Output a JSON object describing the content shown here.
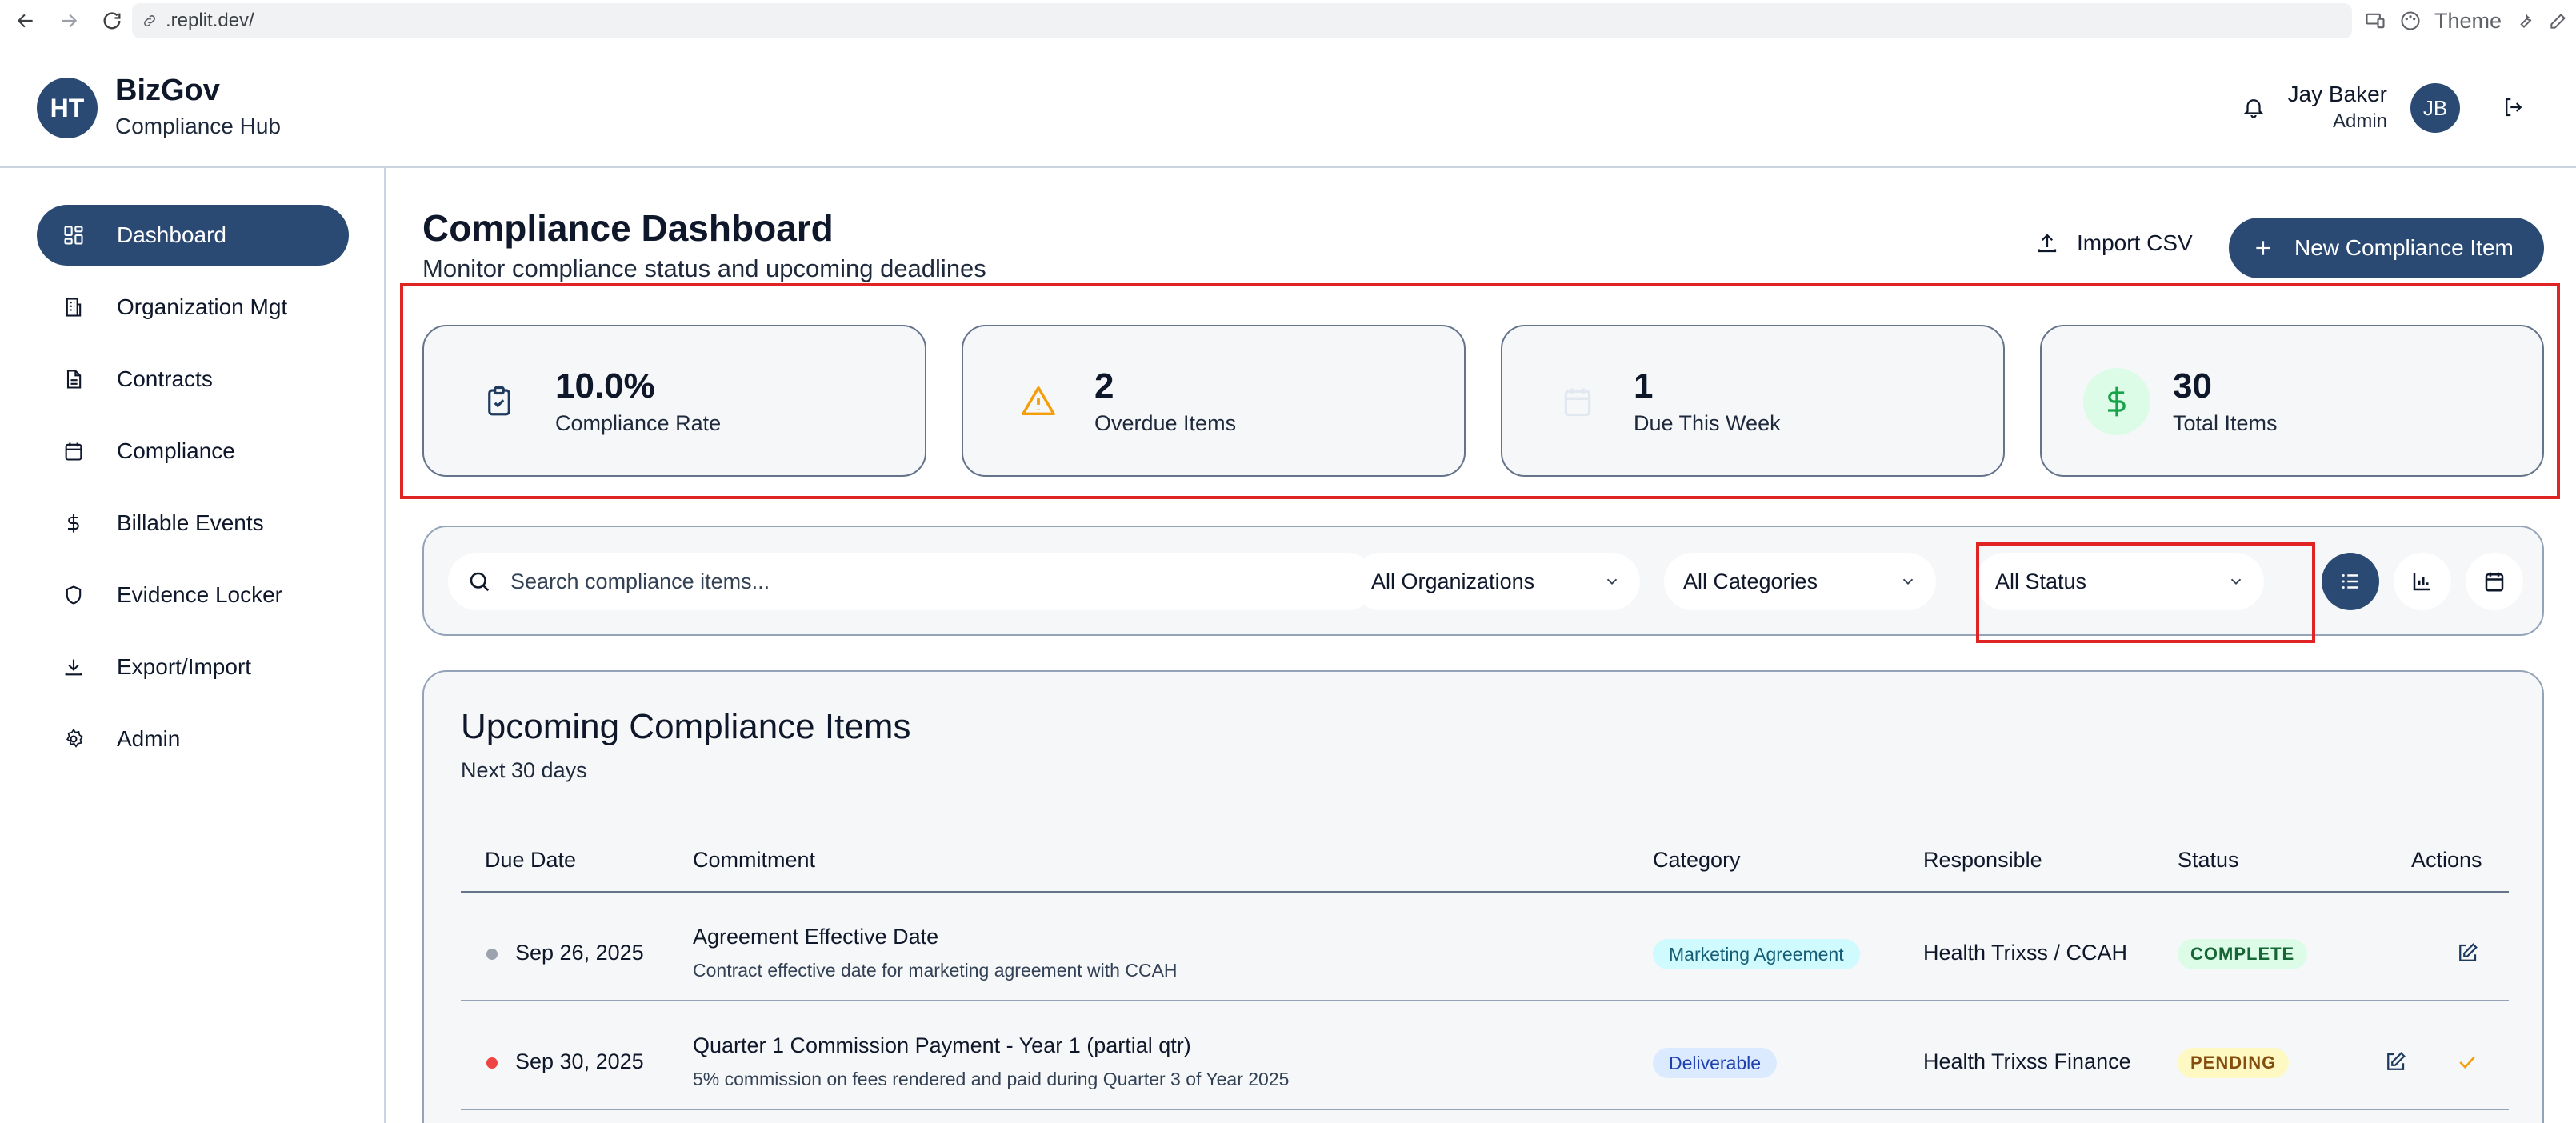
{
  "browser": {
    "url": ".replit.dev/",
    "theme_label": "Theme"
  },
  "header": {
    "logo_initials": "HT",
    "brand_title": "BizGov",
    "brand_subtitle": "Compliance Hub",
    "user_name": "Jay Baker",
    "user_role": "Admin",
    "user_initials": "JB"
  },
  "sidebar": {
    "items": [
      {
        "label": "Dashboard",
        "icon": "dashboard-icon",
        "active": true
      },
      {
        "label": "Organization Mgt",
        "icon": "building-icon",
        "active": false
      },
      {
        "label": "Contracts",
        "icon": "document-icon",
        "active": false
      },
      {
        "label": "Compliance",
        "icon": "calendar-icon",
        "active": false
      },
      {
        "label": "Billable Events",
        "icon": "dollar-icon",
        "active": false
      },
      {
        "label": "Evidence Locker",
        "icon": "shield-icon",
        "active": false
      },
      {
        "label": "Export/Import",
        "icon": "download-icon",
        "active": false
      },
      {
        "label": "Admin",
        "icon": "gear-icon",
        "active": false
      }
    ]
  },
  "page": {
    "title": "Compliance Dashboard",
    "subtitle": "Monitor compliance status and upcoming deadlines",
    "import_label": "Import CSV",
    "new_item_label": "New Compliance Item"
  },
  "stats": [
    {
      "value": "10.0%",
      "label": "Compliance Rate",
      "icon": "clipboard-check-icon",
      "color": "#1e3a5f"
    },
    {
      "value": "2",
      "label": "Overdue Items",
      "icon": "warning-icon",
      "color": "#f59e0b"
    },
    {
      "value": "1",
      "label": "Due This Week",
      "icon": "calendar-icon",
      "color": "#e2e8f0"
    },
    {
      "value": "30",
      "label": "Total Items",
      "icon": "dollar-icon",
      "color": "#16a34a"
    }
  ],
  "filters": {
    "search_placeholder": "Search compliance items...",
    "organizations": "All Organizations",
    "categories": "All Categories",
    "status": "All Status",
    "view_modes": [
      "list-view-icon",
      "chart-view-icon",
      "calendar-view-icon"
    ]
  },
  "upcoming": {
    "title": "Upcoming Compliance Items",
    "subtitle": "Next 30 days",
    "columns": [
      "Due Date",
      "Commitment",
      "Category",
      "Responsible",
      "Status",
      "Actions"
    ],
    "rows": [
      {
        "date": "Sep 26, 2025",
        "dot_color": "#9ca3af",
        "title": "Agreement Effective Date",
        "description": "Contract effective date for marketing agreement with CCAH",
        "category": "Marketing Agreement",
        "category_color": "#cffafe",
        "category_text": "#155e75",
        "responsible": "Health Trixss / CCAH",
        "status": "COMPLETE",
        "status_bg": "#dcfce7",
        "status_text": "#166534"
      },
      {
        "date": "Sep 30, 2025",
        "dot_color": "#ef4444",
        "title": "Quarter 1 Commission Payment - Year 1 (partial qtr)",
        "description": "5% commission on fees rendered and paid during Quarter 3 of Year 2025",
        "category": "Deliverable",
        "category_color": "#dbeafe",
        "category_text": "#1e40af",
        "responsible": "Health Trixss Finance",
        "status": "PENDING",
        "status_bg": "#fef9c3",
        "status_text": "#854d0e"
      }
    ]
  }
}
